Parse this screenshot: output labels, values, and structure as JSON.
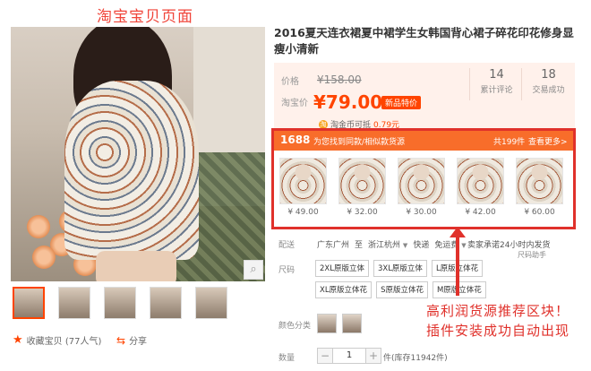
{
  "annotation_title": "淘宝宝贝页面",
  "product": {
    "title": "2016夏天连衣裙夏中裙学生女韩国背心裙子碎花印花修身显瘦小清新",
    "price_label": "价格",
    "original_price": "¥158.00",
    "sale_label": "淘宝价",
    "sale_price": "¥79.00",
    "promo_tag": "新品特价",
    "stats": [
      {
        "num": "14",
        "label": "累计评论"
      },
      {
        "num": "18",
        "label": "交易成功"
      }
    ],
    "coin_text": "淘金币可抵",
    "coin_value": "0.79元"
  },
  "rec": {
    "logo": "1688",
    "text": "为您找到同款/相似款货源",
    "count": "共199件",
    "more": "查看更多>",
    "items": [
      {
        "price": "¥ 49.00"
      },
      {
        "price": "¥ 32.00"
      },
      {
        "price": "¥ 30.00"
      },
      {
        "price": "¥ 42.00"
      },
      {
        "price": "¥ 60.00"
      }
    ]
  },
  "delivery": {
    "label": "配送",
    "from": "广东广州",
    "to_word": "至",
    "to": "浙江杭州",
    "method": "快递",
    "fee": "免运费",
    "promise": "卖家承诺24小时内发货",
    "sub": "尺码助手"
  },
  "size": {
    "label": "尺码",
    "options": [
      "2XL原版立体",
      "3XL原版立体",
      "L原版立体花",
      "XL原版立体花",
      "S原版立体花",
      "M原版立体花"
    ]
  },
  "color": {
    "label": "颜色分类"
  },
  "quantity": {
    "label": "数量",
    "minus": "−",
    "value": "1",
    "plus": "+",
    "stock": "件(库存11942件)"
  },
  "left": {
    "favorite": "收藏宝贝 (77人气)",
    "share": "分享"
  },
  "annotation": {
    "line1": "高利润货源推荐区块！",
    "line2": "插件安装成功自动出现"
  },
  "colors": {
    "accent": "#f40",
    "annotation_red": "#e0312b",
    "rec_header": "#f86d2a"
  }
}
